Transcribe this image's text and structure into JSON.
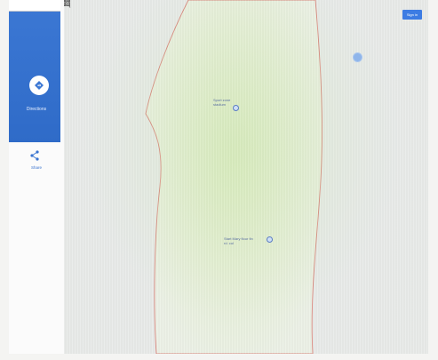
{
  "sidebar": {
    "directions_label": "Directions",
    "share_label": "Share"
  },
  "header": {
    "signin_label": "Sign in"
  },
  "map": {
    "places": [
      {
        "label": "Sport zone\nstadium"
      },
      {
        "label": "Start Mary flour fin\nrd. cul"
      }
    ],
    "colors": {
      "primary_blue": "#3c78d4",
      "boundary_red": "#d9837a",
      "area_fill": "#e7f0d6"
    }
  }
}
